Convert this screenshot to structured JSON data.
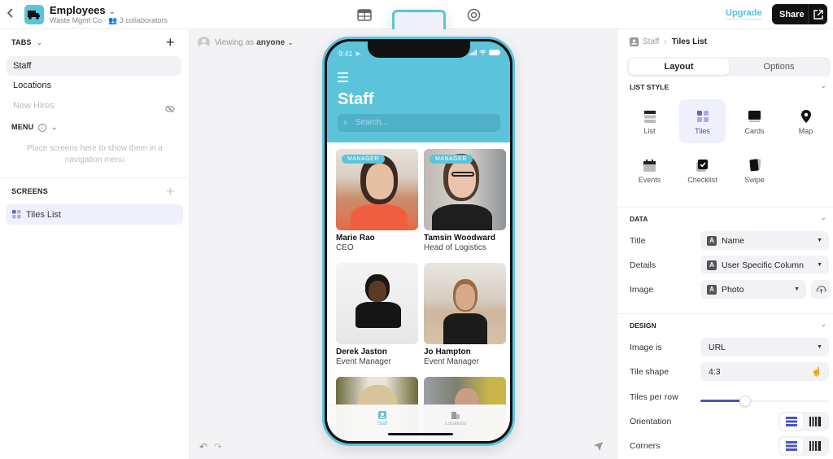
{
  "app": {
    "title": "Employees",
    "org": "Waste Mgmt Co",
    "collaborators": "3 collaborators",
    "upgrade_label": "Upgrade",
    "share_label": "Share"
  },
  "left": {
    "tabs_header": "TABS",
    "tabs": [
      {
        "label": "Staff",
        "selected": true
      },
      {
        "label": "Locations"
      },
      {
        "label": "New Hires",
        "hidden": true
      }
    ],
    "menu_header": "MENU",
    "menu_hint": "Place screens here to show them in a navigation menu",
    "screens_header": "SCREENS",
    "screens": [
      {
        "label": "Tiles List"
      }
    ]
  },
  "canvas": {
    "viewing_prefix": "Viewing as",
    "viewing_as": "anyone"
  },
  "phone": {
    "time": "9:41",
    "title": "Staff",
    "search_placeholder": "Search...",
    "tiles": [
      {
        "name": "Marie Rao",
        "role": "CEO",
        "badge": "MANAGER"
      },
      {
        "name": "Tamsin Woodward",
        "role": "Head of Logistics",
        "badge": "MANAGER"
      },
      {
        "name": "Derek Jaston",
        "role": "Event Manager"
      },
      {
        "name": "Jo Hampton",
        "role": "Event Manager"
      }
    ],
    "tabbar": [
      {
        "label": "Staff",
        "active": true
      },
      {
        "label": "Locations"
      }
    ],
    "accent": "#5bc4db"
  },
  "right": {
    "breadcrumb": {
      "parent": "Staff",
      "current": "Tiles List"
    },
    "segments": [
      "Layout",
      "Options"
    ],
    "list_style_header": "LIST STYLE",
    "styles": [
      {
        "label": "List"
      },
      {
        "label": "Tiles",
        "selected": true
      },
      {
        "label": "Cards"
      },
      {
        "label": "Map"
      },
      {
        "label": "Events"
      },
      {
        "label": "Checklist"
      },
      {
        "label": "Swipe"
      }
    ],
    "data_header": "DATA",
    "data_fields": [
      {
        "label": "Title",
        "value": "Name"
      },
      {
        "label": "Details",
        "value": "User Specific Column"
      },
      {
        "label": "Image",
        "value": "Photo"
      }
    ],
    "design_header": "DESIGN",
    "image_is_label": "Image is",
    "image_is_value": "URL",
    "tile_shape_label": "Tile shape",
    "tile_shape_value": "4:3",
    "tiles_per_row_label": "Tiles per row",
    "tiles_per_row_fraction": 0.35,
    "orientation_label": "Orientation",
    "corners_label": "Corners",
    "accent": "#4b55b8"
  }
}
